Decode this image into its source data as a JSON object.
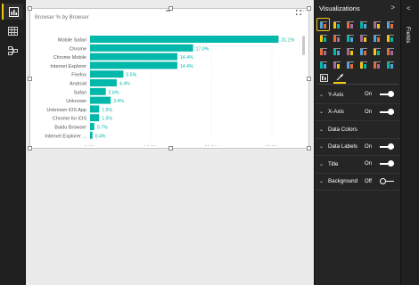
{
  "nav": {
    "items": [
      {
        "name": "report-view",
        "icon": "bar-chart-icon",
        "active": true
      },
      {
        "name": "data-view",
        "icon": "table-icon",
        "active": false
      },
      {
        "name": "relationships-view",
        "icon": "relationships-icon",
        "active": false
      }
    ]
  },
  "visual": {
    "title": "Browser % by Browser",
    "toolbar_grip": "═",
    "more": "···"
  },
  "chart_data": {
    "type": "bar",
    "orientation": "horizontal",
    "categories": [
      "Mobile Safari",
      "Chrome",
      "Chrome Mobile",
      "Internet Explorer",
      "Firefox",
      "Android",
      "Safari",
      "Unknown",
      "Unknown iOS App",
      "Chrome for iOS",
      "Baidu Browser",
      "Internet Explorer ..."
    ],
    "values": [
      31.1,
      17.0,
      14.4,
      14.4,
      5.5,
      4.4,
      2.6,
      3.4,
      1.5,
      1.5,
      0.7,
      0.4
    ],
    "data_labels": [
      "31.1%",
      "17.0%",
      "14.4%",
      "14.4%",
      "5.5%",
      "4.4%",
      "2.6%",
      "3.4%",
      "1.5%",
      "1.5%",
      "0.7%",
      "0.4%"
    ],
    "x_ticks": [
      0,
      10,
      20,
      30
    ],
    "x_tick_labels": [
      "0.0%",
      "10.0%",
      "20.0%",
      "30.0%"
    ],
    "xlim": [
      0,
      35
    ],
    "bar_color": "#01b8aa",
    "grid": true
  },
  "viz_panel": {
    "title": "Visualizations",
    "collapse_glyph": ">",
    "icons": [
      "stacked-bar-icon",
      "stacked-column-icon",
      "clustered-bar-icon",
      "clustered-column-icon",
      "100-bar-icon",
      "100-column-icon",
      "line-chart-icon",
      "area-chart-icon",
      "stacked-area-icon",
      "line-column-icon",
      "line-clustered-icon",
      "ribbon-chart-icon",
      "waterfall-icon",
      "scatter-icon",
      "pie-icon",
      "treemap-icon",
      "map-icon",
      "table-icon",
      "filled-map-icon",
      "gauge-icon",
      "card-icon",
      "multirow-card-icon",
      "kpi-icon",
      "donut-icon"
    ],
    "selected_icon": "stacked-bar-icon",
    "tabs": [
      {
        "name": "fields-tab",
        "icon": "fields-icon",
        "active": false
      },
      {
        "name": "format-tab",
        "icon": "paint-roller-icon",
        "active": true
      }
    ],
    "properties": [
      {
        "label": "Y-Axis",
        "state": "On",
        "toggle": true
      },
      {
        "label": "X-Axis",
        "state": "On",
        "toggle": true
      },
      {
        "label": "Data Colors",
        "state": "",
        "toggle": null
      },
      {
        "label": "Data Labels",
        "state": "On",
        "toggle": true
      },
      {
        "label": "Title",
        "state": "On",
        "toggle": true
      },
      {
        "label": "Background",
        "state": "Off",
        "toggle": false
      }
    ]
  },
  "fields_panel": {
    "label": "Fields",
    "collapse_glyph": "<"
  },
  "colors": {
    "accent": "#f2c811",
    "bar": "#01b8aa",
    "panel": "#252526"
  }
}
